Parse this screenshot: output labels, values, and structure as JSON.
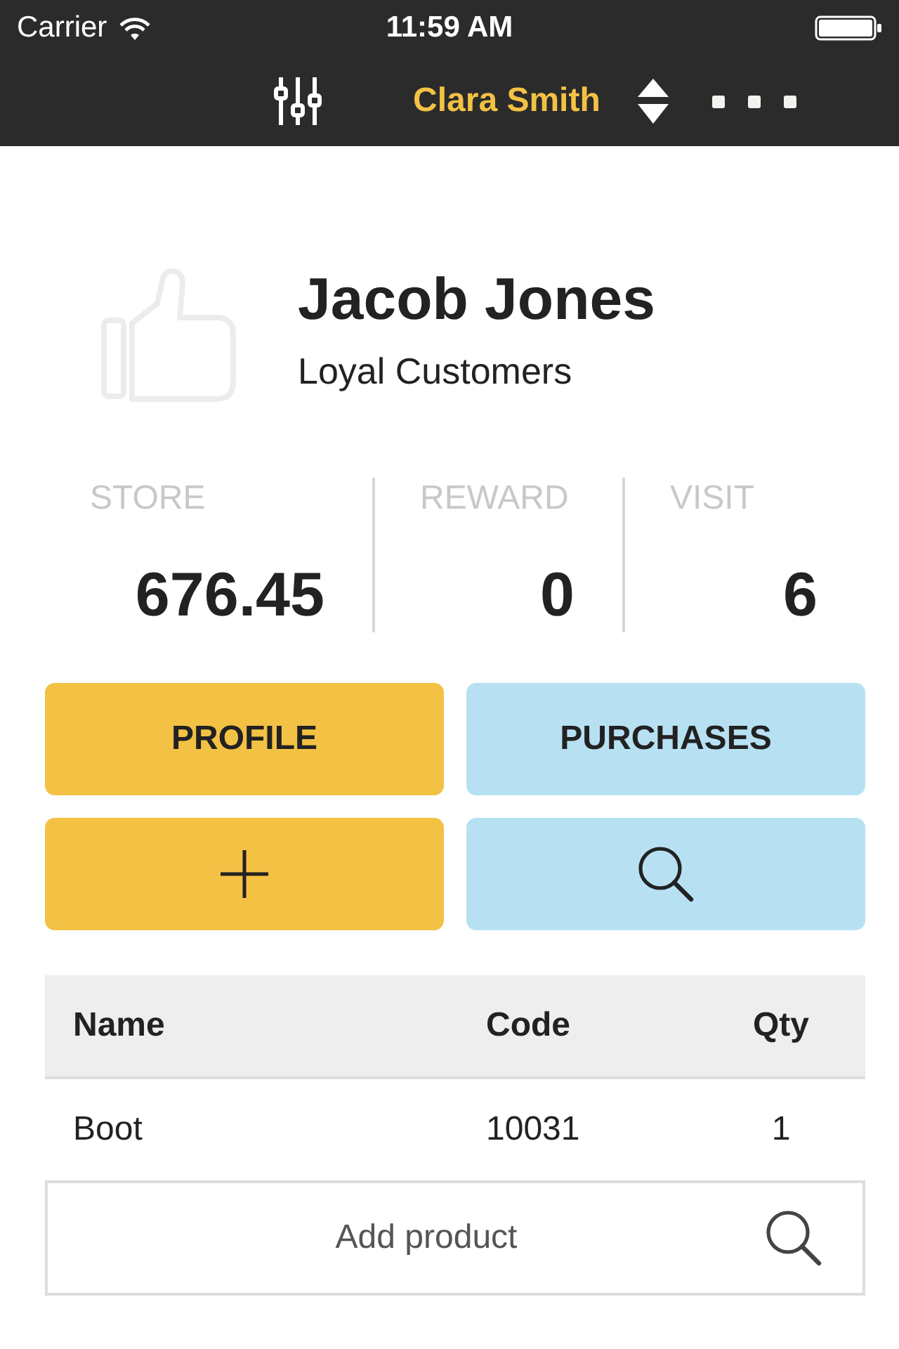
{
  "status_bar": {
    "carrier": "Carrier",
    "time": "11:59 AM"
  },
  "nav_bar": {
    "title": "Clara Smith"
  },
  "profile": {
    "name": "Jacob Jones",
    "group": "Loyal Customers"
  },
  "stats": [
    {
      "label": "STORE",
      "value": "676.45"
    },
    {
      "label": "REWARD",
      "value": "0"
    },
    {
      "label": "VISIT",
      "value": "6"
    }
  ],
  "actions": [
    {
      "kind": "text",
      "label": "PROFILE",
      "color": "#f3c144"
    },
    {
      "kind": "text",
      "label": "PURCHASES",
      "color": "#b7e1f3"
    },
    {
      "kind": "add",
      "color": "#f3c144"
    },
    {
      "kind": "search",
      "color": "#b7e1f3"
    }
  ],
  "table": {
    "columns": [
      "Name",
      "Code",
      "Qty"
    ],
    "rows": [
      [
        "Boot",
        "10031",
        "1"
      ]
    ]
  },
  "add_product": {
    "placeholder": "Add product"
  }
}
